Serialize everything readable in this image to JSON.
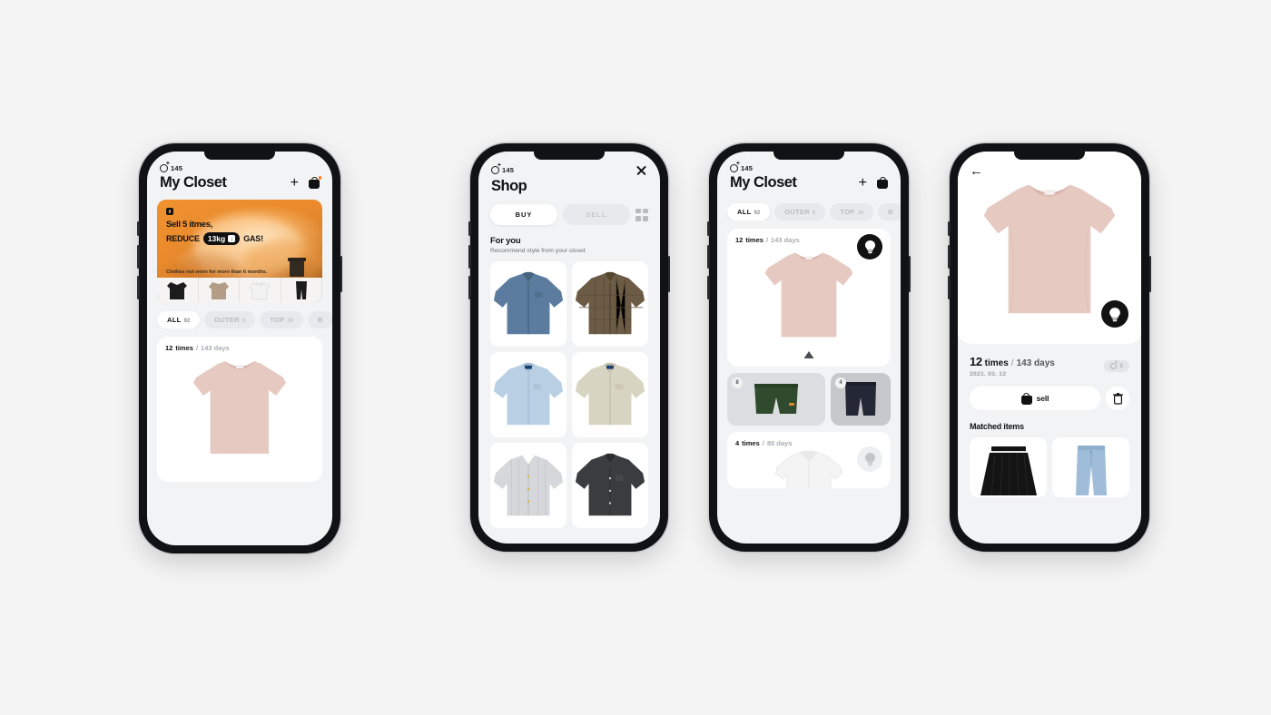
{
  "background_color": "#f4f4f4",
  "phones": {
    "closet_home": {
      "status": {
        "credits": "145",
        "icon": "coin-plus-icon"
      },
      "header": {
        "title": "My Closet",
        "add_icon": "plus-icon",
        "bag_icon": "shopping-bag-icon"
      },
      "banner": {
        "line1": "Sell 5 itmes,",
        "line2_prefix": "REDUCE",
        "chip_value": "13kg",
        "chip_arrow": "↓",
        "line2_suffix": "GAS!",
        "footnote": "Clothes not worn for more than 6 months.",
        "accent_color": "#e98a2c",
        "thumbs": [
          "black-cardigan",
          "brown-knit-sweater",
          "white-hoodie",
          "black-pants"
        ]
      },
      "categories": [
        {
          "label": "ALL",
          "count": "92",
          "selected": true
        },
        {
          "label": "OUTER",
          "count": "6",
          "selected": false
        },
        {
          "label": "TOP",
          "count": "34",
          "selected": false
        },
        {
          "label": "B",
          "count": "",
          "selected": false
        }
      ],
      "item": {
        "times": "12",
        "times_unit": "times",
        "separator": "/",
        "days": "143 days"
      }
    },
    "shop": {
      "status": {
        "credits": "145",
        "icon": "coin-plus-icon"
      },
      "header": {
        "title": "Shop",
        "close_icon": "close-icon"
      },
      "tabs": [
        {
          "label": "BUY",
          "selected": true
        },
        {
          "label": "SELL",
          "selected": false
        }
      ],
      "grid_toggle_icon": "grid-view-icon",
      "section": {
        "title": "For you",
        "subtitle": "Recommend style from your closet"
      },
      "products": [
        {
          "name": "denim-blue-shirt",
          "color": "#5b7c9e"
        },
        {
          "name": "brown-plaid-shirt",
          "color": "#6c5c45"
        },
        {
          "name": "light-blue-oxford-shirt",
          "color": "#b9cfe4"
        },
        {
          "name": "cream-beige-shirt",
          "color": "#d8d4c2"
        },
        {
          "name": "light-gray-striped-shirt",
          "color": "#d5d7da"
        },
        {
          "name": "dark-charcoal-shirt",
          "color": "#3a3c40"
        }
      ]
    },
    "closet_expanded": {
      "status": {
        "credits": "145",
        "icon": "coin-plus-icon"
      },
      "header": {
        "title": "My Closet",
        "add_icon": "plus-icon",
        "bag_icon": "shopping-bag-icon"
      },
      "categories": [
        {
          "label": "ALL",
          "count": "92",
          "selected": true
        },
        {
          "label": "OUTER",
          "count": "6",
          "selected": false
        },
        {
          "label": "TOP",
          "count": "34",
          "selected": false
        },
        {
          "label": "B",
          "count": "",
          "selected": false
        }
      ],
      "item1": {
        "times": "12",
        "times_unit": "times",
        "separator": "/",
        "days": "143 days",
        "bulb_icon": "lightbulb-icon",
        "expand_icon": "triangle-up-icon"
      },
      "pair": [
        {
          "badge": "8",
          "name": "green-shorts",
          "color": "#2f4a2c"
        },
        {
          "badge": "4",
          "name": "navy-shorts",
          "color": "#232736"
        }
      ],
      "item2": {
        "times": "4",
        "times_unit": "times",
        "separator": "/",
        "days": "80 days",
        "bulb_icon": "lightbulb-icon"
      }
    },
    "item_detail": {
      "back_icon": "back-arrow-icon",
      "hero": {
        "name": "pink-tshirt",
        "color": "#e5c8c0",
        "bulb_icon": "lightbulb-icon"
      },
      "meta": {
        "times": "12",
        "times_unit": "times",
        "separator": "/",
        "days": "143 days",
        "date": "2021. 03. 12",
        "credit_badge": "5"
      },
      "actions": {
        "sell_label": "sell",
        "sell_icon": "shopping-bag-icon",
        "delete_icon": "trash-icon"
      },
      "matched": {
        "title": "Matched items",
        "items": [
          {
            "name": "black-pleated-skirt",
            "color": "#141414"
          },
          {
            "name": "light-blue-wide-jeans",
            "color": "#9fbdd8"
          }
        ]
      }
    }
  }
}
